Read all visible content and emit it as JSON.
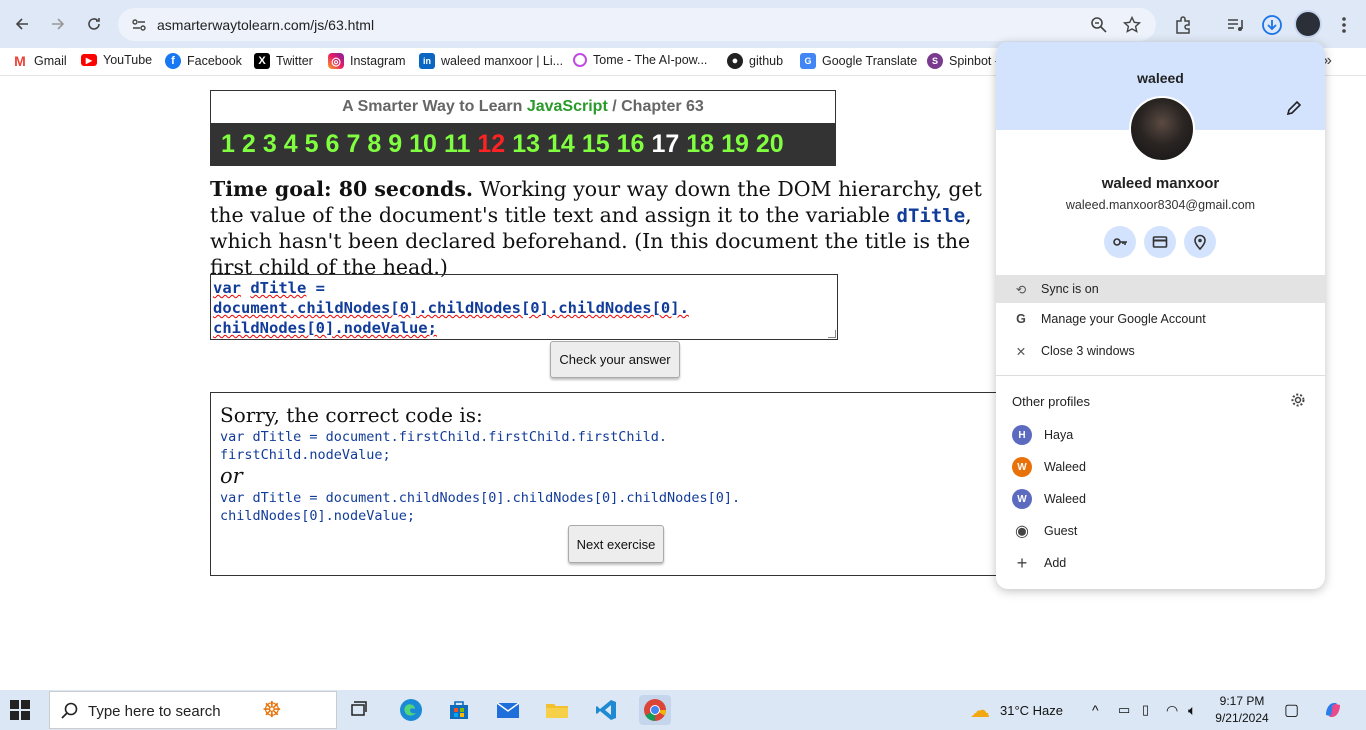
{
  "browser": {
    "url": "asmarterwaytolearn.com/js/63.html"
  },
  "bookmarks": [
    {
      "label": "Gmail",
      "icon": "gmail-icon"
    },
    {
      "label": "YouTube",
      "icon": "youtube-icon"
    },
    {
      "label": "Facebook",
      "icon": "facebook-icon"
    },
    {
      "label": "Twitter",
      "icon": "x-twitter-icon"
    },
    {
      "label": "Instagram",
      "icon": "instagram-icon"
    },
    {
      "label": "waleed manxoor | Li...",
      "icon": "linkedin-icon"
    },
    {
      "label": "Tome - The AI-pow...",
      "icon": "tome-icon"
    },
    {
      "label": "github",
      "icon": "github-icon"
    },
    {
      "label": "Google Translate",
      "icon": "google-translate-icon"
    },
    {
      "label": "Spinbot -",
      "icon": "spinbot-icon"
    }
  ],
  "page": {
    "chapter": {
      "title_prefix": "A Smarter Way to Learn",
      "title_js": "JavaScript",
      "title_sep": "/",
      "title_suffix": "Chapter 63",
      "numbers": [
        "1",
        "2",
        "3",
        "4",
        "5",
        "6",
        "7",
        "8",
        "9",
        "10",
        "11",
        "12",
        "13",
        "14",
        "15",
        "16",
        "17",
        "18",
        "19",
        "20"
      ]
    },
    "instructions": {
      "goal": "Time goal: 80 seconds.",
      "text1": " Working your way down the DOM hierarchy, get the value of the document's title text and assign it to the variable ",
      "var": "dTitle",
      "text2": ", which hasn't been declared beforehand. (In this document the title is the first child of the head.)"
    },
    "answer": {
      "line1a": "var",
      "line1b": "dTitle",
      "line1c": " =",
      "line2": "document.childNodes[0].childNodes[0].childNodes[0].",
      "line3": "childNodes[0].nodeValue;"
    },
    "check_button": "Check your answer",
    "result": {
      "sorry": "Sorry, the correct code is:",
      "code1_line1": "var dTitle = document.firstChild.firstChild.firstChild.",
      "code1_line2": "firstChild.nodeValue;",
      "or": "or",
      "code2_line1": "var dTitle = document.childNodes[0].childNodes[0].childNodes[0].",
      "code2_line2": "childNodes[0].nodeValue;"
    },
    "next_button": "Next exercise"
  },
  "profile": {
    "name": "waleed",
    "full_name": "waleed manxoor",
    "email": "waleed.manxoor8304@gmail.com",
    "sync": "Sync is on",
    "manage": "Manage your Google Account",
    "close": "Close 3 windows",
    "other_profiles_title": "Other profiles",
    "others": [
      {
        "letter": "H",
        "name": "Haya",
        "color": "#5c6bc0"
      },
      {
        "letter": "W",
        "name": "Waleed",
        "color": "#e8710a"
      },
      {
        "letter": "W",
        "name": "Waleed",
        "color": "#5c6bc0"
      }
    ],
    "guest": "Guest",
    "add": "Add"
  },
  "taskbar": {
    "search_placeholder": "Type here to search",
    "weather": "31°C  Haze",
    "time": "9:17 PM",
    "date": "9/21/2024"
  }
}
